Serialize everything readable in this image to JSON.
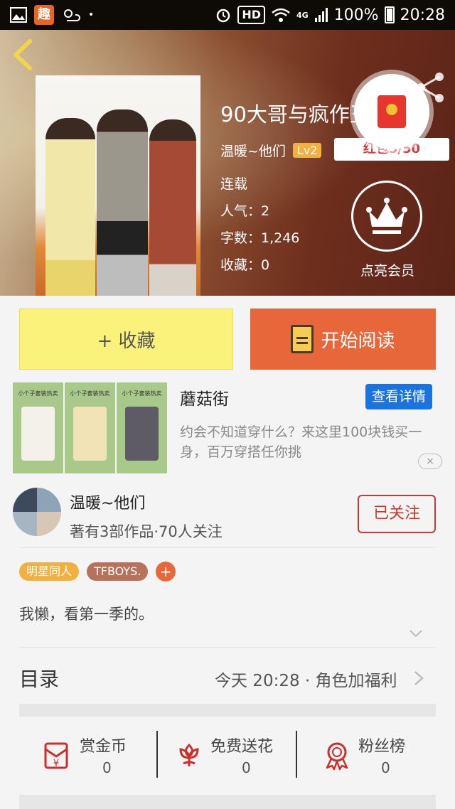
{
  "status_bar": {
    "hd": "HD",
    "network": "4G",
    "battery": "100%",
    "time": "20:28",
    "app_badge": "趣"
  },
  "book": {
    "title": "90大哥与疯作王",
    "author": "温暖~他们",
    "level": "Lv2",
    "red_packet": "红包5/50",
    "status": "连载",
    "popularity": "人气：2",
    "word_count": "字数：1,246",
    "favorites": "收藏：0",
    "vip_label": "点亮会员"
  },
  "actions": {
    "collect": "+ 收藏",
    "read": "开始阅读"
  },
  "ad": {
    "panel_caption": "小个子套装热卖",
    "title": "蘑菇街",
    "detail_button": "查看详情",
    "description": "约会不知道穿什么？来这里100块钱买一身，百万穿搭任你挑",
    "close": "×"
  },
  "author_card": {
    "name": "温暖~他们",
    "info": "著有3部作品·70人关注",
    "follow": "已关注"
  },
  "tags": [
    {
      "label": "明星同人",
      "color": "#f2b13e"
    },
    {
      "label": "TFBOYS.",
      "color": "#b8715a"
    }
  ],
  "tag_add": "+",
  "intro": "我懒，看第一季的。",
  "catalog": {
    "label": "目录",
    "update": "今天 20:28 · 角色加福利"
  },
  "stats": [
    {
      "label": "赏金币",
      "value": "0",
      "icon": "reward-coin-icon"
    },
    {
      "label": "免费送花",
      "value": "0",
      "icon": "flower-icon"
    },
    {
      "label": "粉丝榜",
      "value": "0",
      "icon": "fan-ranking-icon"
    }
  ],
  "colors": {
    "accent": "#e8673a",
    "collect": "#fbf27c",
    "follow": "#c63a32",
    "detail": "#1b73de"
  }
}
